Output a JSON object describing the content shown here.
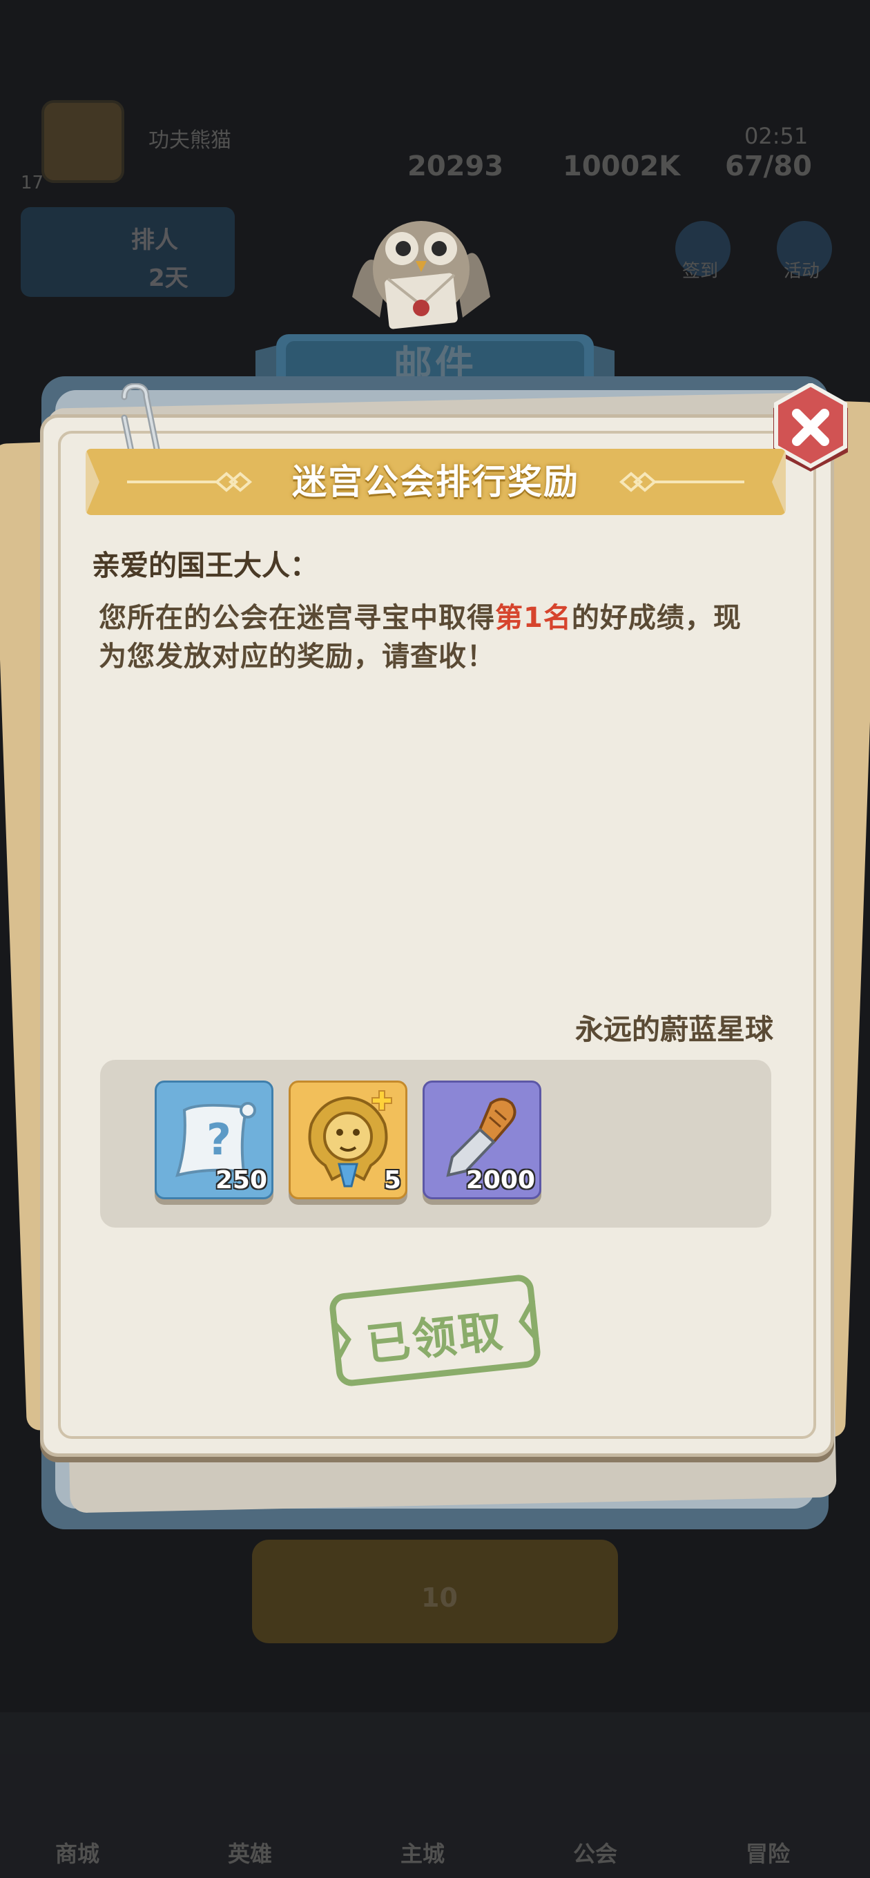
{
  "background": {
    "player_name": "功夫熊猫",
    "player_level": "17",
    "time": "02:51",
    "gems": "20293",
    "gold": "10002K",
    "energy": "67/80",
    "banner_line1": "排人",
    "banner_line2": "2天",
    "right_btn1": "签到",
    "right_btn2": "活动",
    "collect_count": "10",
    "nav": [
      "商城",
      "英雄",
      "主城",
      "公会",
      "冒险"
    ]
  },
  "mail": {
    "window_title": "邮件",
    "subject": "迷宫公会排行奖励",
    "greeting": "亲爱的国王大人：",
    "body_line1_before": "您所在的公会在迷宫寻宝中取得",
    "body_rank": "第1名",
    "body_line1_after": "的好成绩，现",
    "body_line2": "为您发放对应的奖励，请查收！",
    "sender": "永远的蔚蓝星球",
    "rewards": [
      {
        "icon": "mystery-scroll-icon",
        "count": "250",
        "bg": "#6fb0db"
      },
      {
        "icon": "golden-lion-crest-icon",
        "count": "5",
        "bg": "#f2bf5a"
      },
      {
        "icon": "chisel-tool-icon",
        "count": "2000",
        "bg": "#8b86d6"
      }
    ],
    "claimed_label": "已领取"
  },
  "colors": {
    "ribbon": "#e2b95c",
    "rank_highlight": "#d6442d",
    "close_button": "#c94848",
    "claimed_stamp": "#8aac6a"
  }
}
